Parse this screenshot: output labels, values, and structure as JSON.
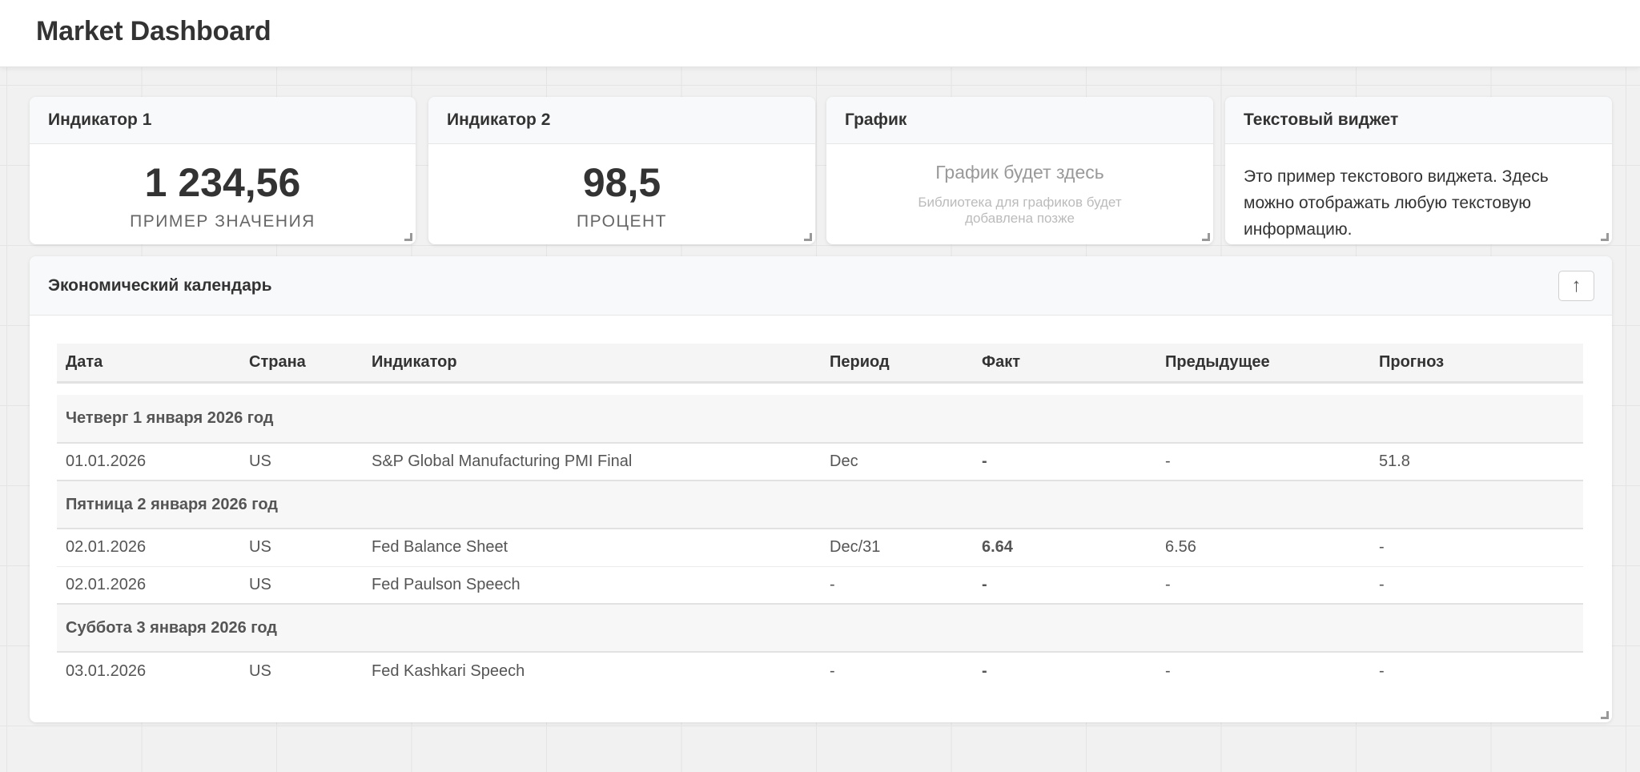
{
  "app": {
    "title": "Market Dashboard"
  },
  "widgets": {
    "indicator1": {
      "title": "Индикатор 1",
      "value": "1 234,56",
      "label": "ПРИМЕР ЗНАЧЕНИЯ"
    },
    "indicator2": {
      "title": "Индикатор 2",
      "value": "98,5",
      "label": "ПРОЦЕНТ"
    },
    "chart": {
      "title": "График",
      "placeholder": "График будет здесь",
      "note": "Библиотека для графиков будет добавлена позже"
    },
    "text": {
      "title": "Текстовый виджет",
      "body": "Это пример текстового виджета. Здесь можно отображать любую текстовую информацию."
    }
  },
  "calendar": {
    "title": "Экономический календарь",
    "collapse_icon": "arrow-up-icon",
    "collapse_glyph": "↑",
    "columns": [
      "Дата",
      "Страна",
      "Индикатор",
      "Период",
      "Факт",
      "Предыдущее",
      "Прогноз"
    ],
    "groups": [
      {
        "day": "Четверг 1 января 2026 год",
        "rows": [
          {
            "date": "01.01.2026",
            "country": "US",
            "indicator": "S&P Global Manufacturing PMI Final",
            "period": "Dec",
            "actual": "-",
            "previous": "-",
            "forecast": "51.8"
          }
        ]
      },
      {
        "day": "Пятница 2 января 2026 год",
        "rows": [
          {
            "date": "02.01.2026",
            "country": "US",
            "indicator": "Fed Balance Sheet",
            "period": "Dec/31",
            "actual": "6.64",
            "previous": "6.56",
            "forecast": "-"
          },
          {
            "date": "02.01.2026",
            "country": "US",
            "indicator": "Fed Paulson Speech",
            "period": "-",
            "actual": "-",
            "previous": "-",
            "forecast": "-"
          }
        ]
      },
      {
        "day": "Суббота 3 января 2026 год",
        "rows": [
          {
            "date": "03.01.2026",
            "country": "US",
            "indicator": "Fed Kashkari Speech",
            "period": "-",
            "actual": "-",
            "previous": "-",
            "forecast": "-"
          }
        ]
      }
    ]
  }
}
